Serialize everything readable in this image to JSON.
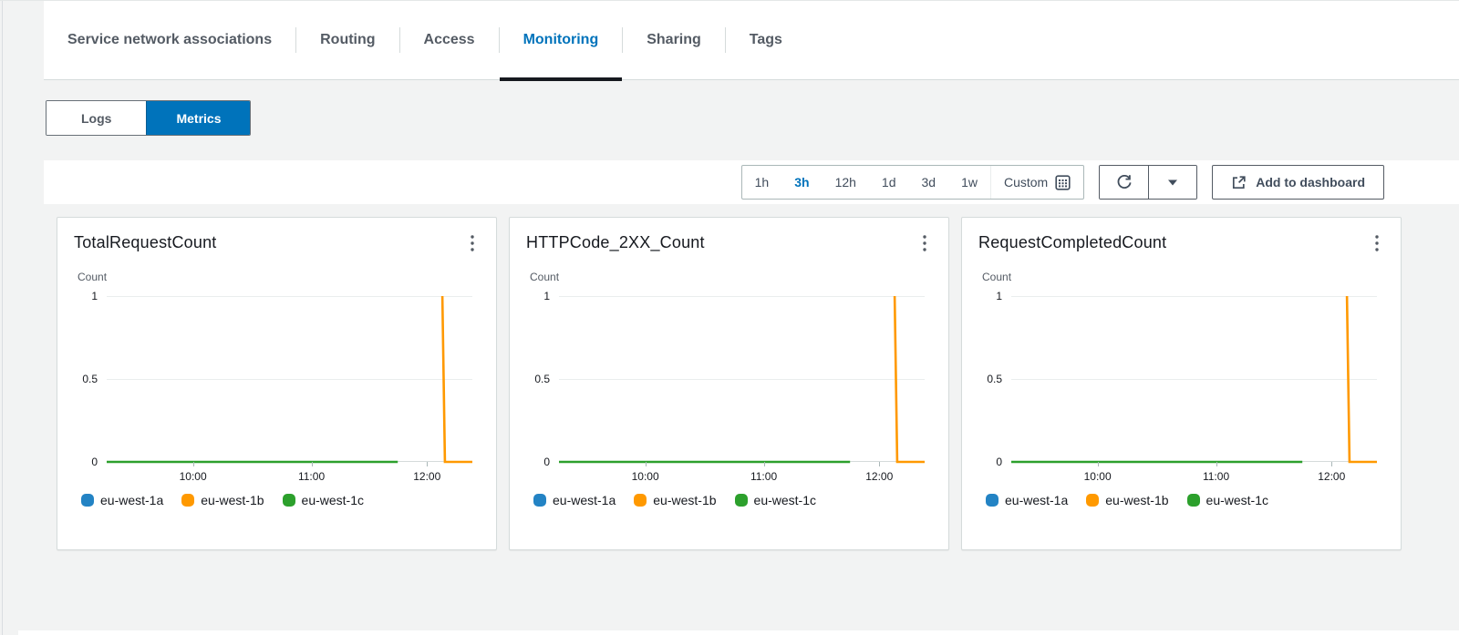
{
  "tabs": {
    "items": [
      {
        "label": "Service network associations",
        "active": false
      },
      {
        "label": "Routing",
        "active": false
      },
      {
        "label": "Access",
        "active": false
      },
      {
        "label": "Monitoring",
        "active": true
      },
      {
        "label": "Sharing",
        "active": false
      },
      {
        "label": "Tags",
        "active": false
      }
    ]
  },
  "view_toggle": {
    "options": [
      {
        "label": "Logs",
        "selected": false
      },
      {
        "label": "Metrics",
        "selected": true
      }
    ]
  },
  "toolbar": {
    "time_ranges": [
      {
        "label": "1h",
        "selected": false
      },
      {
        "label": "3h",
        "selected": true
      },
      {
        "label": "12h",
        "selected": false
      },
      {
        "label": "1d",
        "selected": false
      },
      {
        "label": "3d",
        "selected": false
      },
      {
        "label": "1w",
        "selected": false
      }
    ],
    "custom_label": "Custom",
    "add_to_dashboard_label": "Add to dashboard"
  },
  "colors": {
    "accent_blue": "#0073bb",
    "series_blue": "#2383c4",
    "series_orange": "#ff9900",
    "series_green": "#2ca02c",
    "page_background": "#f2f3f3",
    "card_border": "#d5dbdb"
  },
  "chart_data": [
    {
      "type": "line",
      "title": "TotalRequestCount",
      "ylabel": "Count",
      "ylim": [
        0,
        1
      ],
      "grid": true,
      "legend_position": "bottom",
      "y_ticks": [
        {
          "label": "1",
          "value": 1
        },
        {
          "label": "0.5",
          "value": 0.5
        },
        {
          "label": "0",
          "value": 0
        }
      ],
      "x_ticks": [
        {
          "label": "10:00",
          "pos": 23.6
        },
        {
          "label": "11:00",
          "pos": 56.0
        },
        {
          "label": "12:00",
          "pos": 87.6
        }
      ],
      "series": [
        {
          "name": "eu-west-1a",
          "color": "#2383c4",
          "points": []
        },
        {
          "name": "eu-west-1b",
          "color": "#ff9900",
          "points": [
            [
              91.8,
              1
            ],
            [
              92.5,
              0
            ],
            [
              100,
              0
            ]
          ]
        },
        {
          "name": "eu-west-1c",
          "color": "#2ca02c",
          "points": [
            [
              0,
              0
            ],
            [
              79.6,
              0
            ]
          ]
        }
      ]
    },
    {
      "type": "line",
      "title": "HTTPCode_2XX_Count",
      "ylabel": "Count",
      "ylim": [
        0,
        1
      ],
      "grid": true,
      "legend_position": "bottom",
      "y_ticks": [
        {
          "label": "1",
          "value": 1
        },
        {
          "label": "0.5",
          "value": 0.5
        },
        {
          "label": "0",
          "value": 0
        }
      ],
      "x_ticks": [
        {
          "label": "10:00",
          "pos": 23.6
        },
        {
          "label": "11:00",
          "pos": 56.0
        },
        {
          "label": "12:00",
          "pos": 87.6
        }
      ],
      "series": [
        {
          "name": "eu-west-1a",
          "color": "#2383c4",
          "points": []
        },
        {
          "name": "eu-west-1b",
          "color": "#ff9900",
          "points": [
            [
              91.8,
              1
            ],
            [
              92.5,
              0
            ],
            [
              100,
              0
            ]
          ]
        },
        {
          "name": "eu-west-1c",
          "color": "#2ca02c",
          "points": [
            [
              0,
              0
            ],
            [
              79.6,
              0
            ]
          ]
        }
      ]
    },
    {
      "type": "line",
      "title": "RequestCompletedCount",
      "ylabel": "Count",
      "ylim": [
        0,
        1
      ],
      "grid": true,
      "legend_position": "bottom",
      "y_ticks": [
        {
          "label": "1",
          "value": 1
        },
        {
          "label": "0.5",
          "value": 0.5
        },
        {
          "label": "0",
          "value": 0
        }
      ],
      "x_ticks": [
        {
          "label": "10:00",
          "pos": 23.6
        },
        {
          "label": "11:00",
          "pos": 56.0
        },
        {
          "label": "12:00",
          "pos": 87.6
        }
      ],
      "series": [
        {
          "name": "eu-west-1a",
          "color": "#2383c4",
          "points": []
        },
        {
          "name": "eu-west-1b",
          "color": "#ff9900",
          "points": [
            [
              91.8,
              1
            ],
            [
              92.5,
              0
            ],
            [
              100,
              0
            ]
          ]
        },
        {
          "name": "eu-west-1c",
          "color": "#2ca02c",
          "points": [
            [
              0,
              0
            ],
            [
              79.6,
              0
            ]
          ]
        }
      ]
    }
  ]
}
